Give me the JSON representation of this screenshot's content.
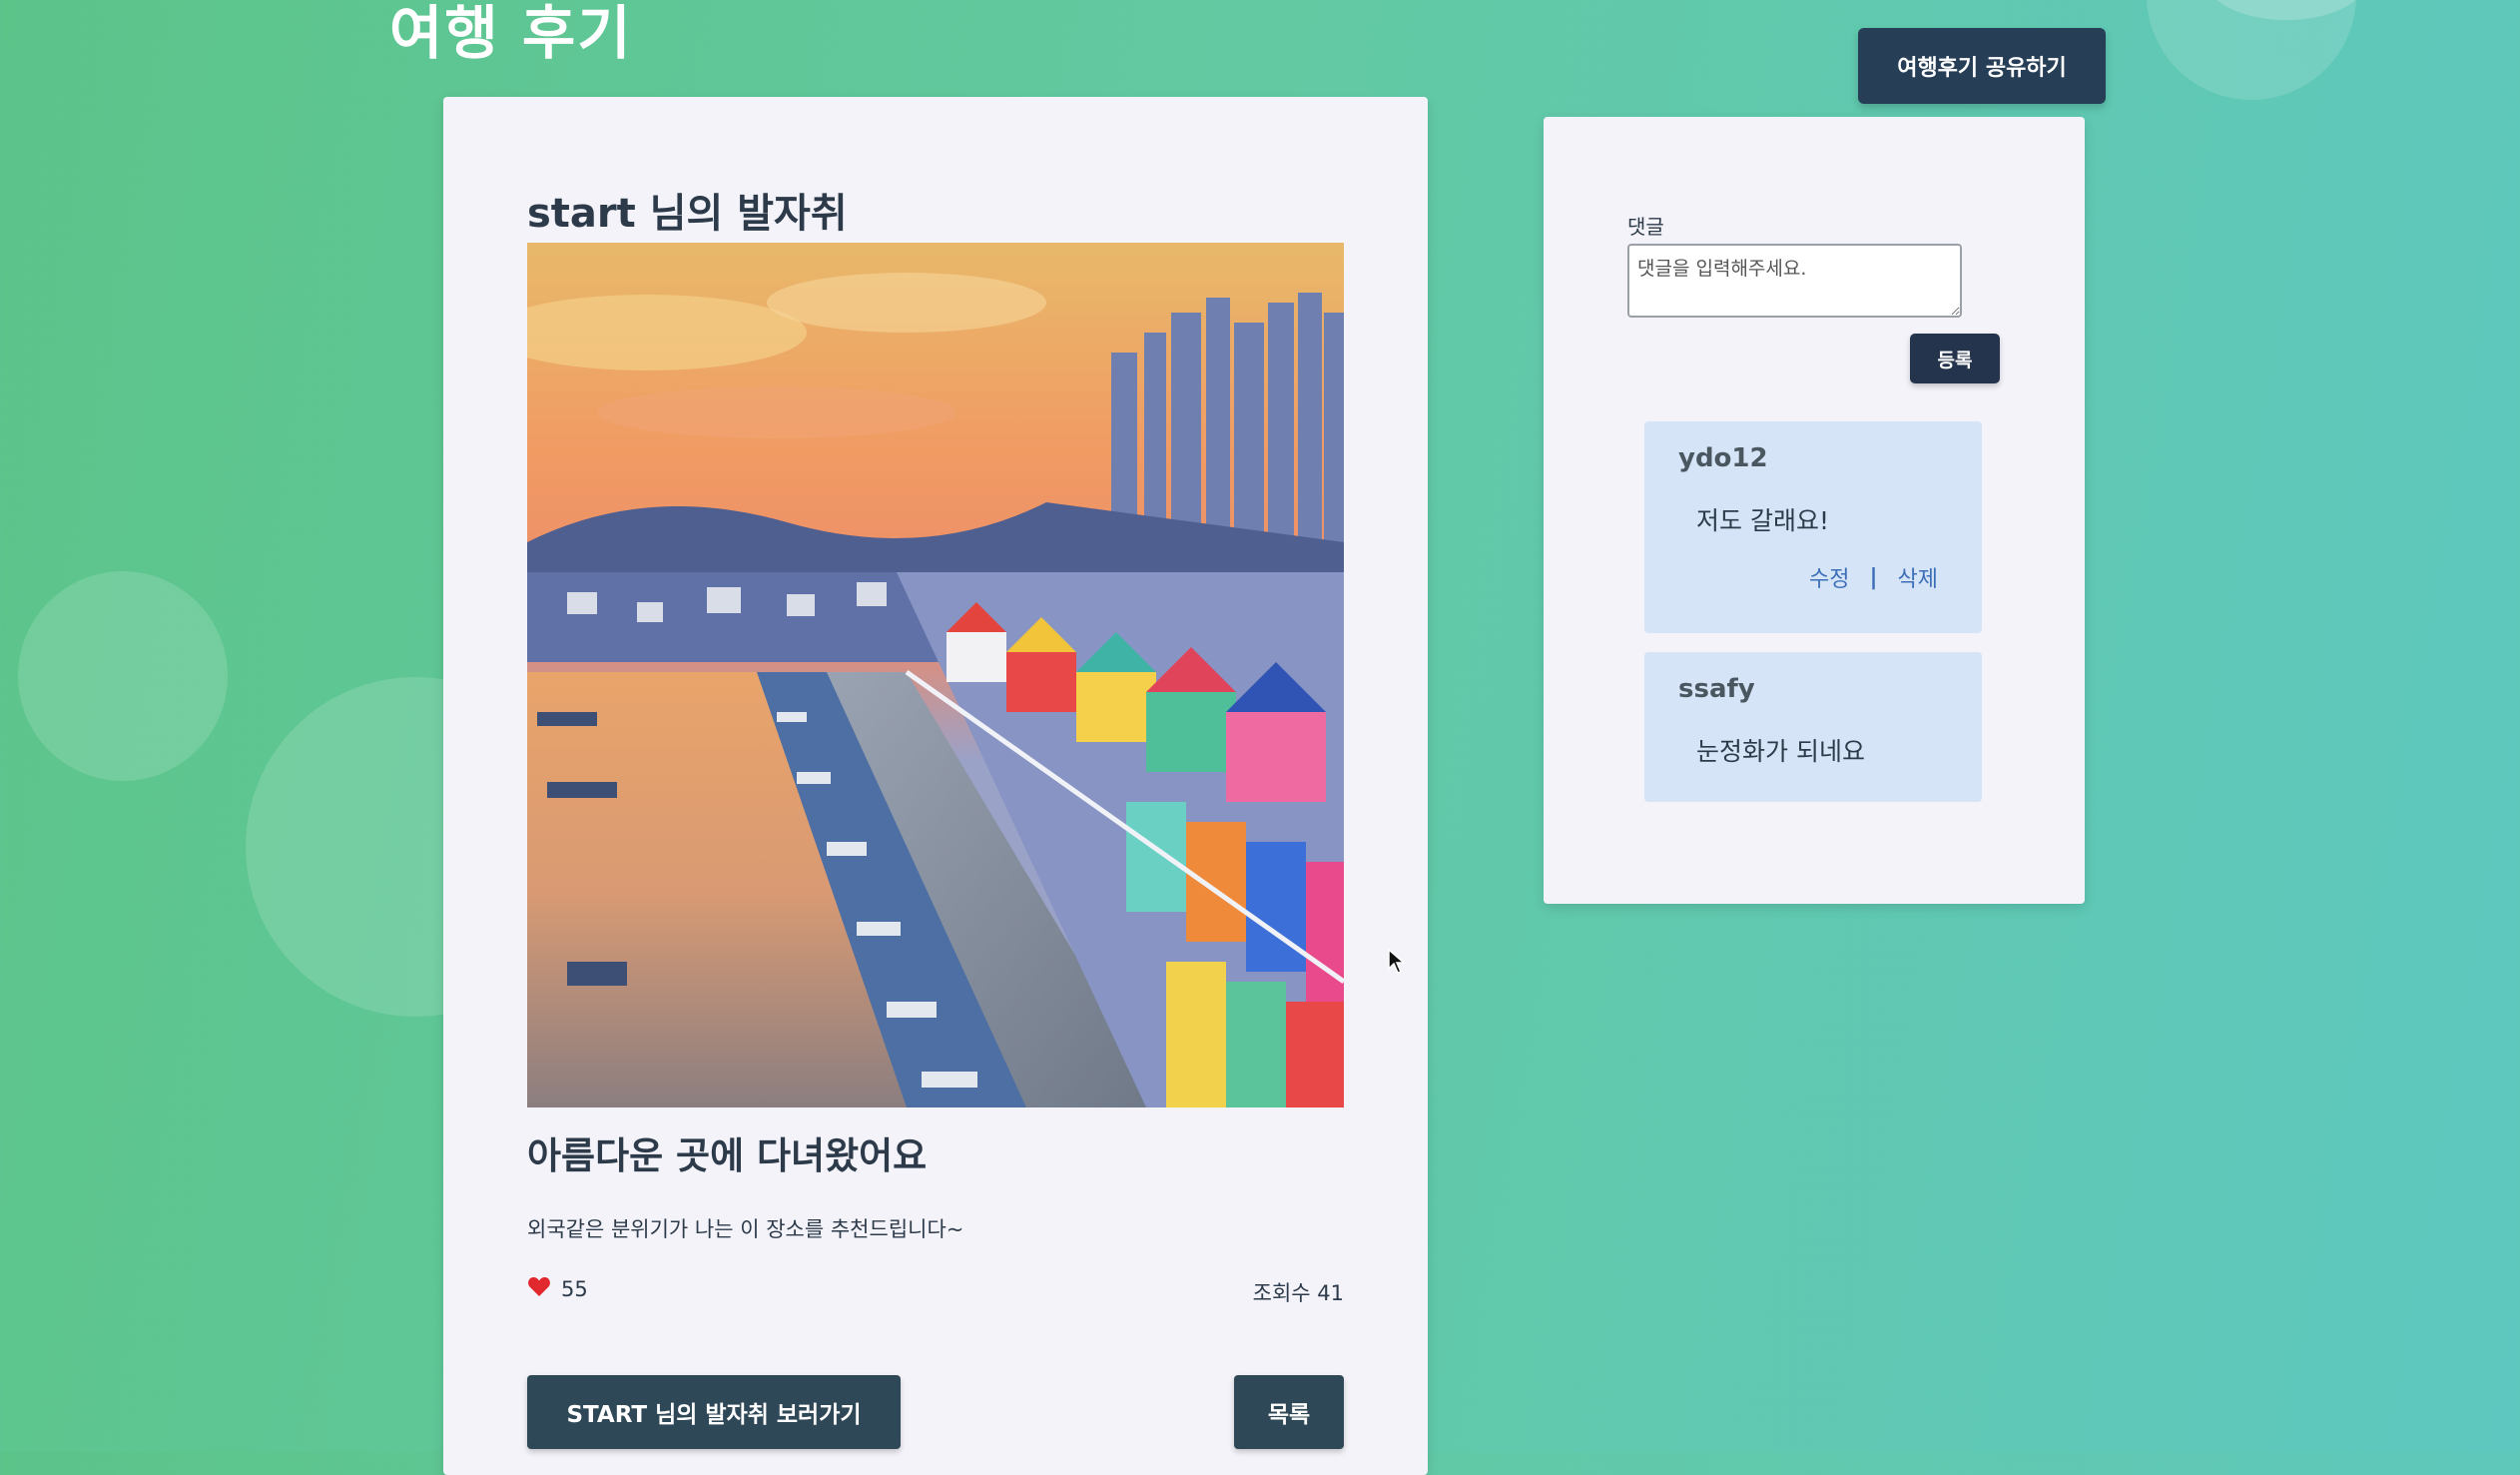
{
  "page": {
    "title": "여행 후기"
  },
  "header": {
    "share_button": "여행후기 공유하기"
  },
  "post": {
    "heading": "start 님의 발자취",
    "subtitle": "아름다운 곳에 다녀왔어요",
    "description": "외국같은 분위기가 나는 이 장소를 추천드립니다~",
    "likes": "55",
    "views": "조회수 41",
    "view_footprints_button": "START 님의 발자취 보러가기",
    "list_button": "목록"
  },
  "comments": {
    "label": "댓글",
    "placeholder": "댓글을 입력해주세요.",
    "submit_button": "등록",
    "items": [
      {
        "author": "ydo12",
        "text": "저도 갈래요!",
        "edit": "수정",
        "separator": "|",
        "delete": "삭제"
      },
      {
        "author": "ssafy",
        "text": "눈정화가 되네요"
      }
    ]
  },
  "colors": {
    "background_start": "#5cc489",
    "background_end": "#5ec8c0",
    "button_dark": "#263f57",
    "comment_bg": "#d5e4f6",
    "link": "#3d6fb8",
    "heart": "#e0282e"
  }
}
